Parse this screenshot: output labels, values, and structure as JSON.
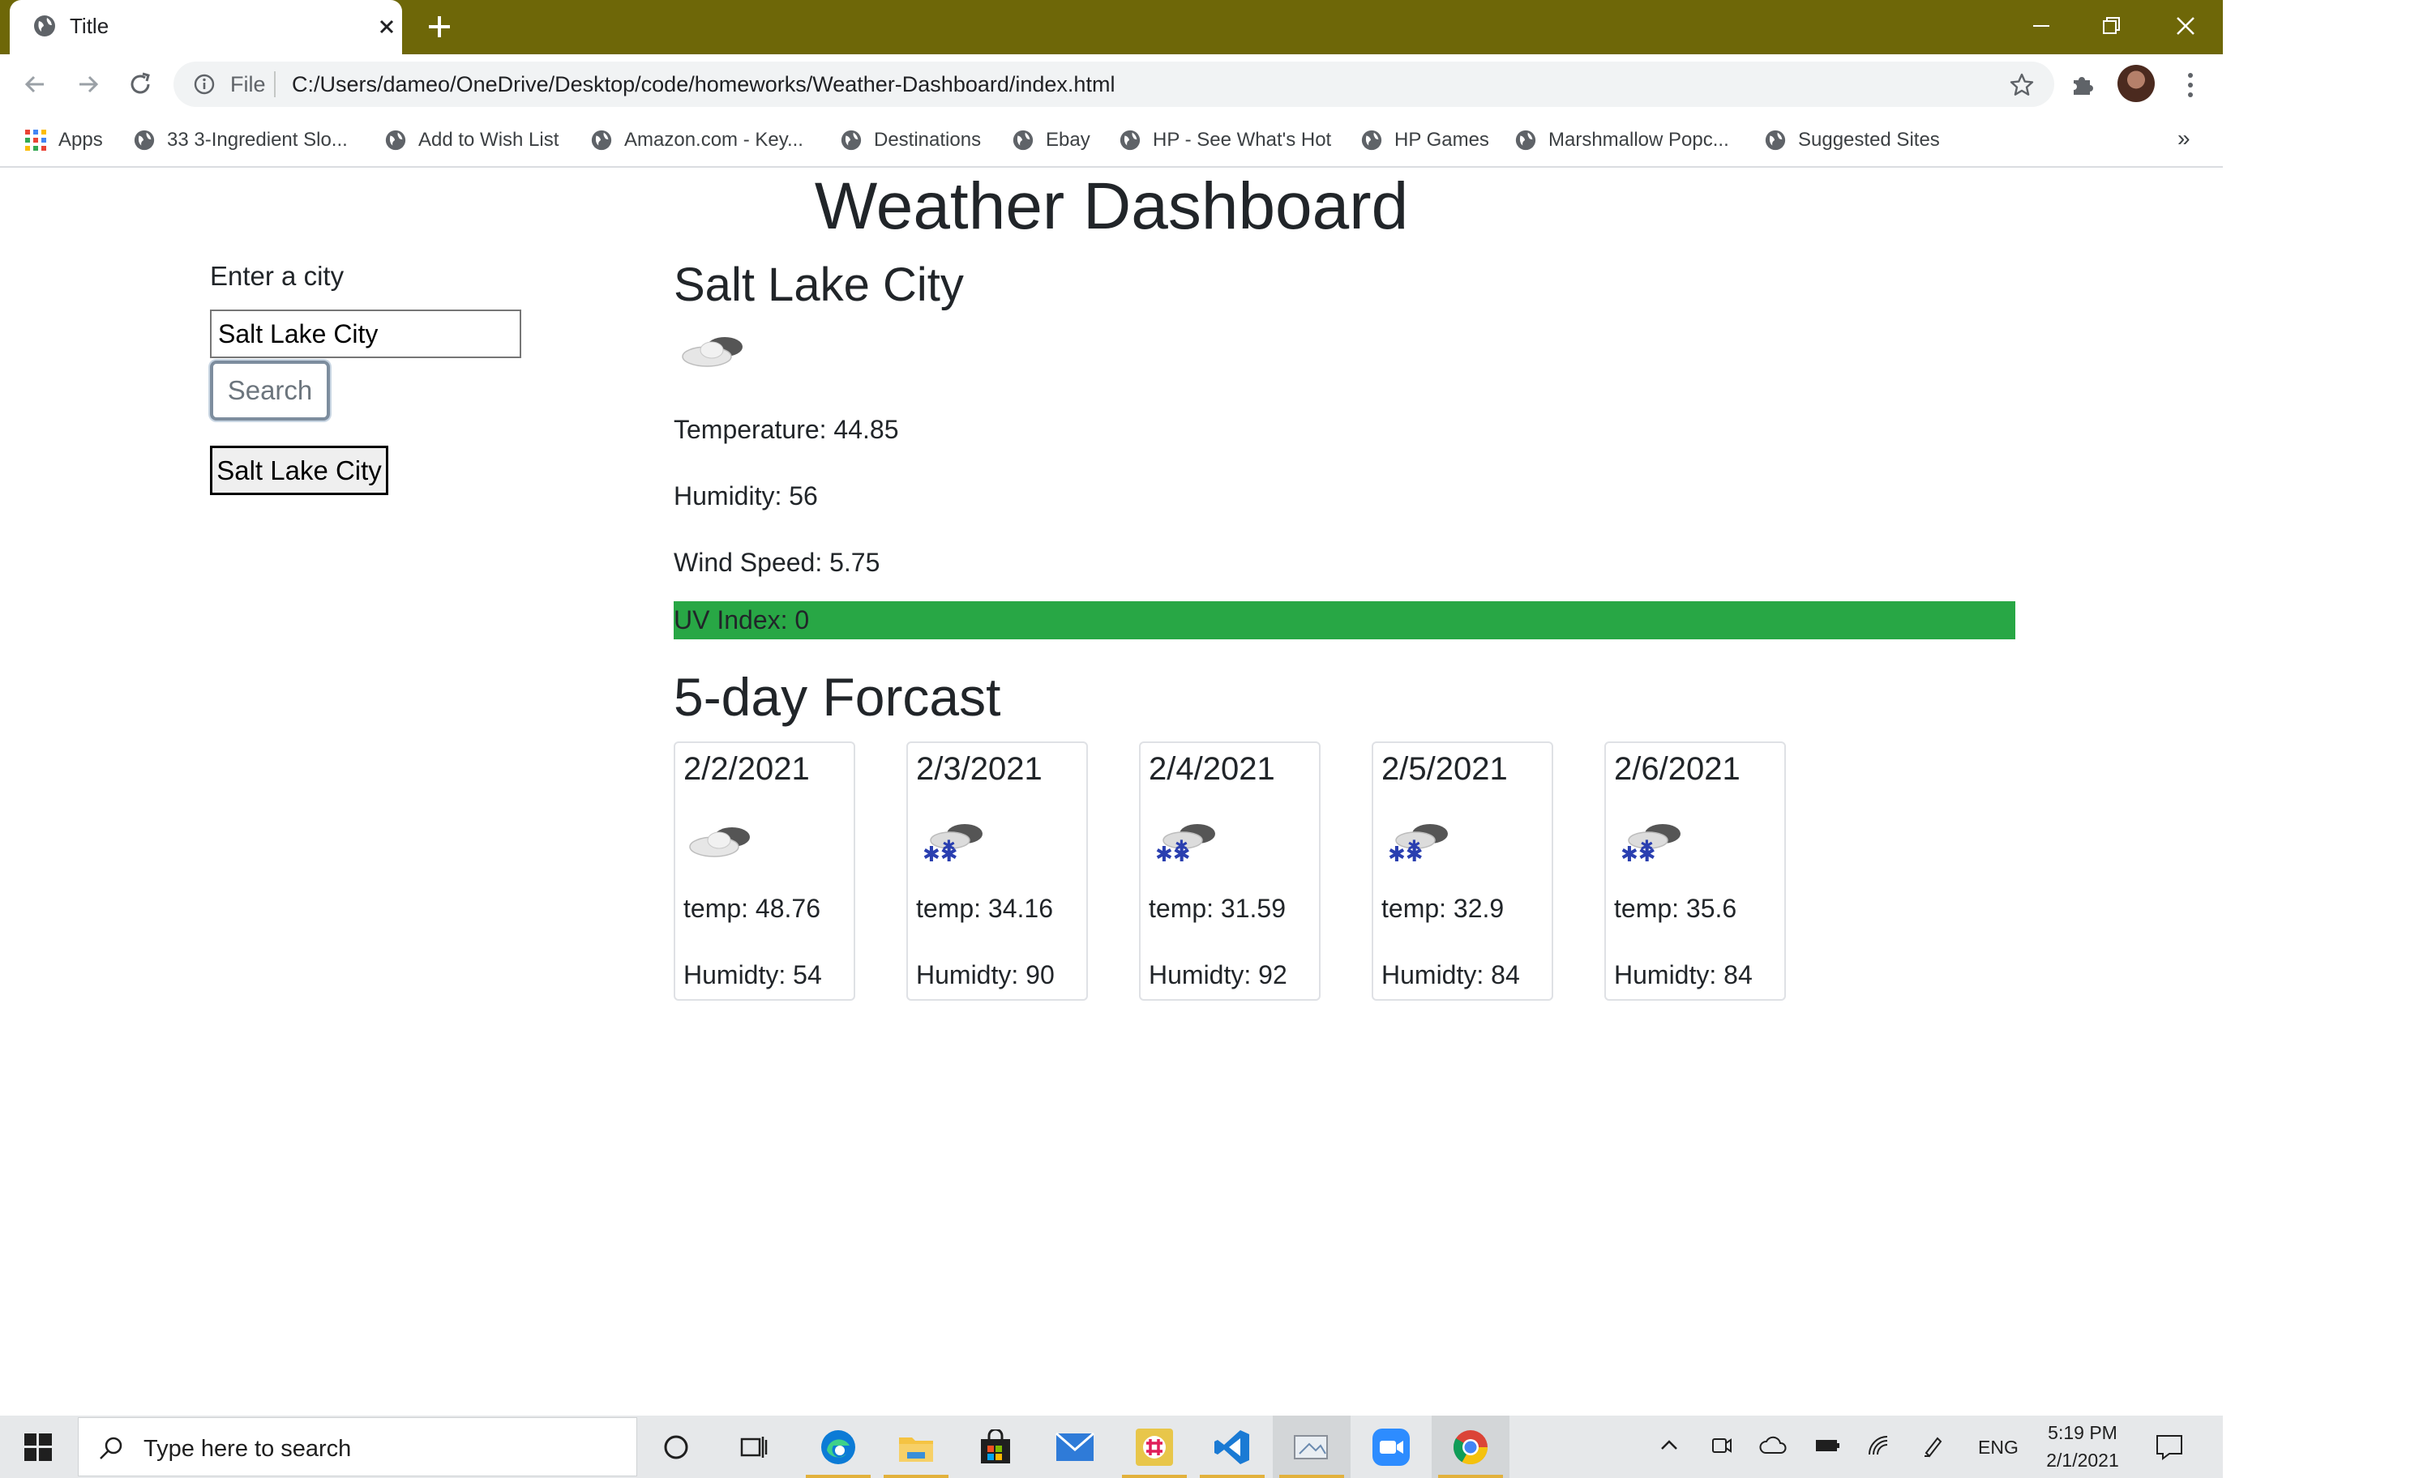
{
  "browser": {
    "tab_title": "Title",
    "address_prefix": "File",
    "url": "C:/Users/dameo/OneDrive/Desktop/code/homeworks/Weather-Dashboard/index.html",
    "bookmarks": [
      "Apps",
      "33 3-Ingredient Slo...",
      "Add to Wish List",
      "Amazon.com - Key...",
      "Destinations",
      "Ebay",
      "HP - See What's Hot",
      "HP Games",
      "Marshmallow Popc...",
      "Suggested Sites"
    ],
    "bookmarks_more": "»",
    "tab_bar_color": "#6e6708"
  },
  "page": {
    "title": "Weather Dashboard",
    "sidebar": {
      "label": "Enter a city",
      "input_value": "Salt Lake City",
      "search_label": "Search",
      "history": [
        "Salt Lake City"
      ]
    },
    "current": {
      "city": "Salt Lake City",
      "icon": "cloudy-icon",
      "temperature": "Temperature: 44.85",
      "humidity": "Humidity: 56",
      "wind": "Wind Speed: 5.75",
      "uv": "UV Index: 0",
      "uv_color": "#28a745"
    },
    "forecast_title": "5-day Forcast",
    "forecast": [
      {
        "date": "2/2/2021",
        "icon": "cloudy-icon",
        "temp": "temp: 48.76",
        "humidity": "Humidty: 54"
      },
      {
        "date": "2/3/2021",
        "icon": "snow-icon",
        "temp": "temp: 34.16",
        "humidity": "Humidty: 90"
      },
      {
        "date": "2/4/2021",
        "icon": "snow-icon",
        "temp": "temp: 31.59",
        "humidity": "Humidty: 92"
      },
      {
        "date": "2/5/2021",
        "icon": "snow-icon",
        "temp": "temp: 32.9",
        "humidity": "Humidty: 84"
      },
      {
        "date": "2/6/2021",
        "icon": "snow-icon",
        "temp": "temp: 35.6",
        "humidity": "Humidty: 84"
      }
    ]
  },
  "taskbar": {
    "search_placeholder": "Type here to search",
    "language": "ENG",
    "time": "5:19 PM",
    "date": "2/1/2021"
  }
}
